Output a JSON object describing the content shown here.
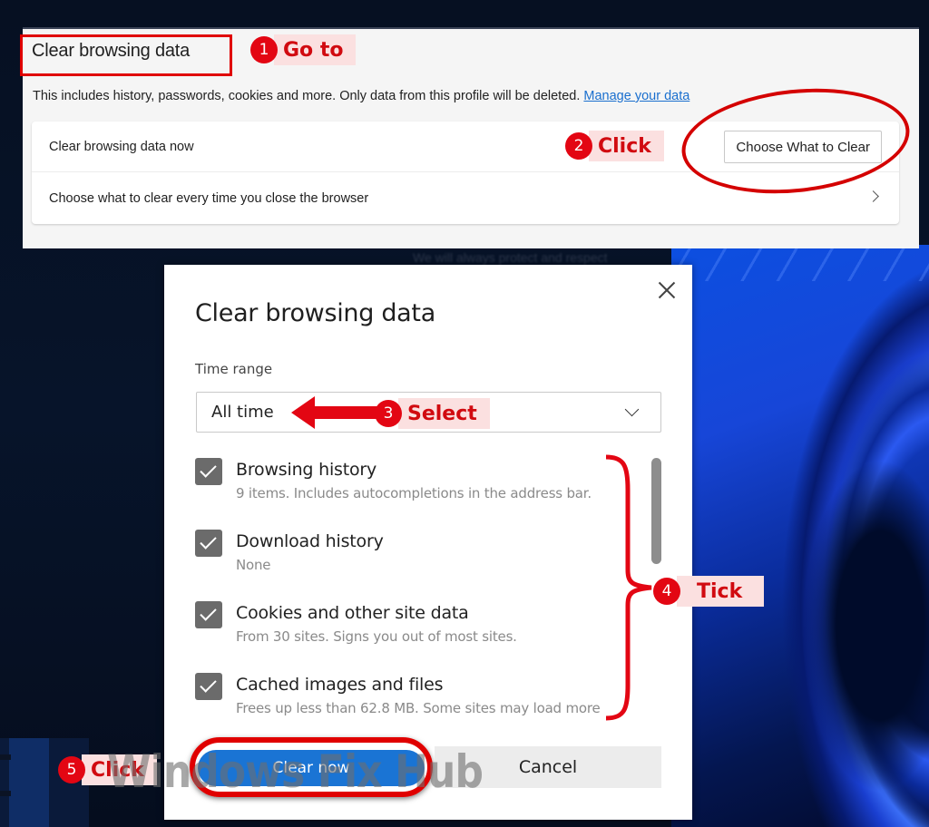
{
  "settings_panel": {
    "title": "Clear browsing data",
    "description": "This includes history, passwords, cookies and more. Only data from this profile will be deleted. ",
    "manage_link": "Manage your data",
    "rows": [
      {
        "label": "Clear browsing data now",
        "button": "Choose What to Clear"
      },
      {
        "label": "Choose what to clear every time you close the browser"
      }
    ]
  },
  "background_text": "We will always protect and respect",
  "dialog": {
    "title": "Clear browsing data",
    "time_range_label": "Time range",
    "time_range_value": "All time",
    "items": [
      {
        "title": "Browsing history",
        "desc": "9 items. Includes autocompletions in the address bar.",
        "checked": true
      },
      {
        "title": "Download history",
        "desc": "None",
        "checked": true
      },
      {
        "title": "Cookies and other site data",
        "desc": "From 30 sites. Signs you out of most sites.",
        "checked": true
      },
      {
        "title": "Cached images and files",
        "desc": "Frees up less than 62.8 MB. Some sites may load more",
        "checked": true
      }
    ],
    "clear_button": "Clear now",
    "cancel_button": "Cancel"
  },
  "annotations": [
    {
      "num": "1",
      "label": "Go to"
    },
    {
      "num": "2",
      "label": "Click"
    },
    {
      "num": "3",
      "label": "Select"
    },
    {
      "num": "4",
      "label": "Tick"
    },
    {
      "num": "5",
      "label": "Click"
    }
  ],
  "watermark": "Windows Fix Hub",
  "colors": {
    "annotation_red": "#e30613",
    "primary_blue": "#1a74d4",
    "link_blue": "#1a6fce"
  }
}
